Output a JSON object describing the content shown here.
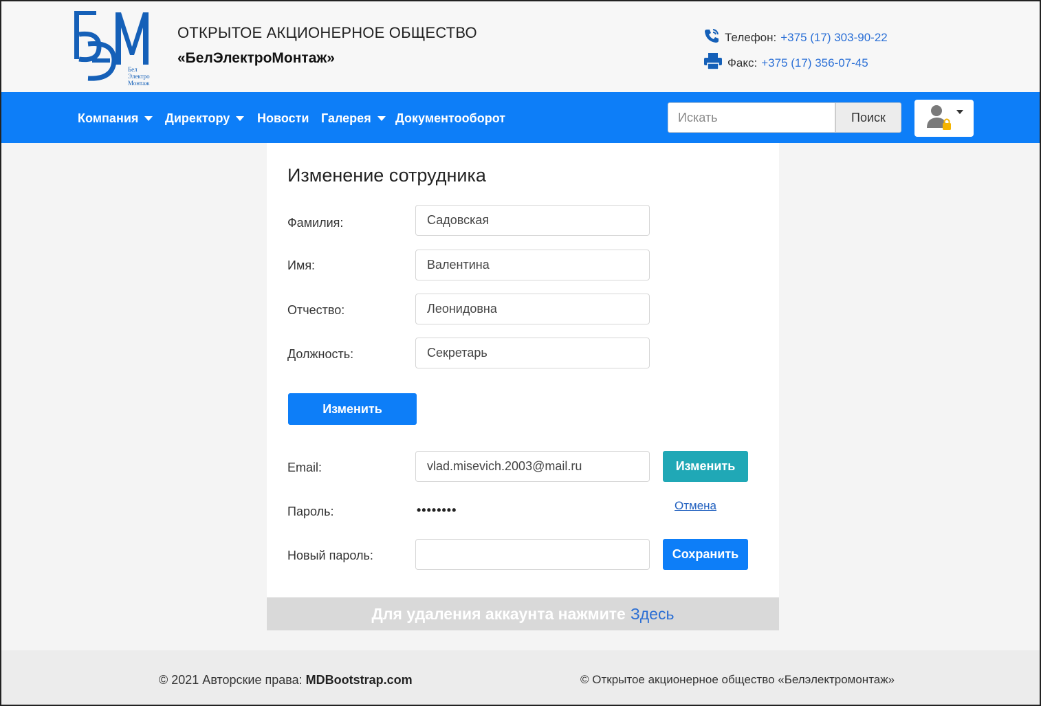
{
  "header": {
    "logo_letters": "БЭМ",
    "logo_caption": "Бел Электро Монтаж",
    "org_line1": "ОТКРЫТОЕ АКЦИОНЕРНОЕ ОБЩЕСТВО",
    "org_line2": "«БелЭлектроМонтаж»",
    "phone_label": "Телефон:",
    "phone_value": "+375 (17) 303-90-22",
    "fax_label": "Факс:",
    "fax_value": "+375 (17) 356-07-45",
    "link_color": "#2a6fd6"
  },
  "navbar": {
    "color": "#0d7ef8",
    "items": [
      {
        "label": "Компания",
        "dropdown": true
      },
      {
        "label": "Директору",
        "dropdown": true
      },
      {
        "label": "Новости",
        "dropdown": false
      },
      {
        "label": "Галерея",
        "dropdown": true
      },
      {
        "label": "Документооборот",
        "dropdown": false
      }
    ],
    "search_placeholder": "Искать",
    "search_button": "Поиск",
    "user_icon": "user-lock-icon"
  },
  "form": {
    "title": "Изменение сотрудника",
    "fields": [
      {
        "label": "Фамилия:",
        "value": "Садовская"
      },
      {
        "label": "Имя:",
        "value": "Валентина"
      },
      {
        "label": "Отчество:",
        "value": "Леонидовна"
      },
      {
        "label": "Должность:",
        "value": "Секретарь"
      }
    ],
    "submit_label": "Изменить",
    "email_label": "Email:",
    "email_value": "vlad.misevich.2003@mail.ru",
    "email_change_label": "Изменить",
    "password_label": "Пароль:",
    "password_masked": "••••••••",
    "cancel_label": "Отмена",
    "new_password_label": "Новый пароль:",
    "new_password_value": "",
    "save_label": "Сохранить"
  },
  "delete_account": {
    "text": "Для удаления аккаунта нажмите",
    "link": "Здесь"
  },
  "footer": {
    "copyright_prefix": "© 2021 Авторские права:",
    "copyright_site": "MDBootstrap.com",
    "right_text": "© Открытое акционерное общество «Белэлектромонтаж»"
  }
}
